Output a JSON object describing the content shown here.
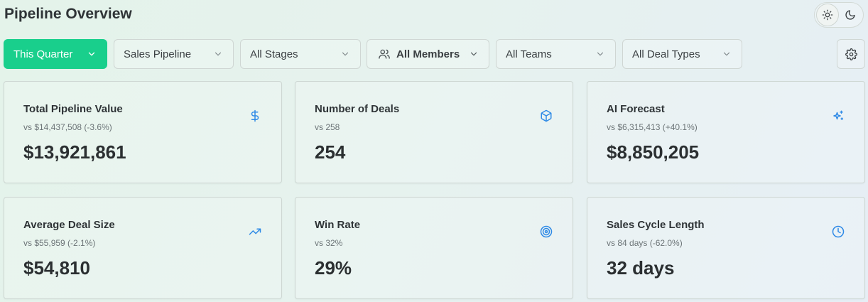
{
  "page": {
    "title": "Pipeline Overview"
  },
  "theme_toggle": {
    "light_icon": "sun-icon",
    "dark_icon": "moon-icon"
  },
  "filters": {
    "period": "This Quarter",
    "pipeline": "Sales Pipeline",
    "stages": "All Stages",
    "members": "All Members",
    "teams": "All Teams",
    "deal_types": "All Deal Types"
  },
  "settings": {
    "icon": "gear-icon"
  },
  "colors": {
    "accent": "#19cf8c",
    "icon_blue": "#2f8ae6"
  },
  "cards": [
    {
      "label": "Total Pipeline Value",
      "compare": "vs $14,437,508 (-3.6%)",
      "value": "$13,921,861",
      "icon": "dollar-icon"
    },
    {
      "label": "Number of Deals",
      "compare": "vs 258",
      "value": "254",
      "icon": "box-icon"
    },
    {
      "label": "AI Forecast",
      "compare": "vs $6,315,413 (+40.1%)",
      "value": "$8,850,205",
      "icon": "sparkles-icon"
    },
    {
      "label": "Average Deal Size",
      "compare": "vs $55,959 (-2.1%)",
      "value": "$54,810",
      "icon": "trending-up-icon"
    },
    {
      "label": "Win Rate",
      "compare": "vs 32%",
      "value": "29%",
      "icon": "target-icon"
    },
    {
      "label": "Sales Cycle Length",
      "compare": "vs 84 days (-62.0%)",
      "value": "32 days",
      "icon": "clock-icon"
    }
  ]
}
